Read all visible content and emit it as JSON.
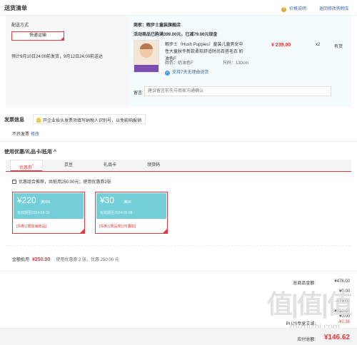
{
  "header": {
    "title": "送货清单",
    "price_note": "价格说明",
    "return_cart": "返回修改购物车"
  },
  "shipping": {
    "label": "配送方式",
    "method": "快递运输",
    "date": "预计9月10日24:00前发货，9月12日24:00前送达"
  },
  "shop": {
    "seller": "商家：暇步士童装旗舰店",
    "promo": "活动商品已购满399.00元，已减79.00元现金",
    "product": {
      "name": "暇步士（Hush Puppies）童装儿童男女中性大童秋冬新款柔软舒适时尚百搭毛衣 奶油色F",
      "price": "¥ 239.00",
      "qty": "x2",
      "stock": "有货",
      "color": "颜色：奶油色F",
      "size": "尺码：130cm",
      "return_policy": "支持7天无理由退货"
    },
    "message_label": "留言:",
    "message_placeholder": "建议留言前先与商家沟通确认"
  },
  "invoice": {
    "title": "发票信息",
    "tip": "开企业抬头发票须填写纳税人识别号，以免影响报销",
    "current": "不开发票",
    "modify": "修改"
  },
  "coupons": {
    "title": "使用优惠/礼品卡/抵用",
    "tabs": [
      "优惠券",
      "京豆",
      "礼品卡",
      "领货码"
    ],
    "combo": "优惠组合推荐，共抵用250.00元；使用优惠券2张",
    "cards": [
      {
        "amount": "¥220",
        "cond": "满399",
        "valid": "有效期至2024-09-30",
        "tags": "[东券] [限店铺商品]"
      },
      {
        "amount": "¥30",
        "cond": "满30",
        "valid": "有效期至2024-09-08",
        "tags": "[东券] [限品类] [可叠加]"
      }
    ],
    "total_label": "金额抵用",
    "total": "¥250.00",
    "info": "使用优惠券 2 张，优惠 250.00 元"
  },
  "summary": {
    "rows": [
      {
        "label": "总商品金额:",
        "value": "¥478.00"
      },
      {
        "label": "",
        "value": "¥0.00"
      },
      {
        "label": "",
        "value": "-¥79.00"
      },
      {
        "label": "",
        "value": "-¥250.00"
      },
      {
        "label": "",
        "value": "¥0.00"
      },
      {
        "label": "PLUS专享立减:",
        "value": "-¥2.38"
      }
    ],
    "pay_label": "应付总额:",
    "pay_total": "¥146.62"
  },
  "watermark": {
    "logo": "值|值|值",
    "site": "zhizhizhi.com"
  }
}
